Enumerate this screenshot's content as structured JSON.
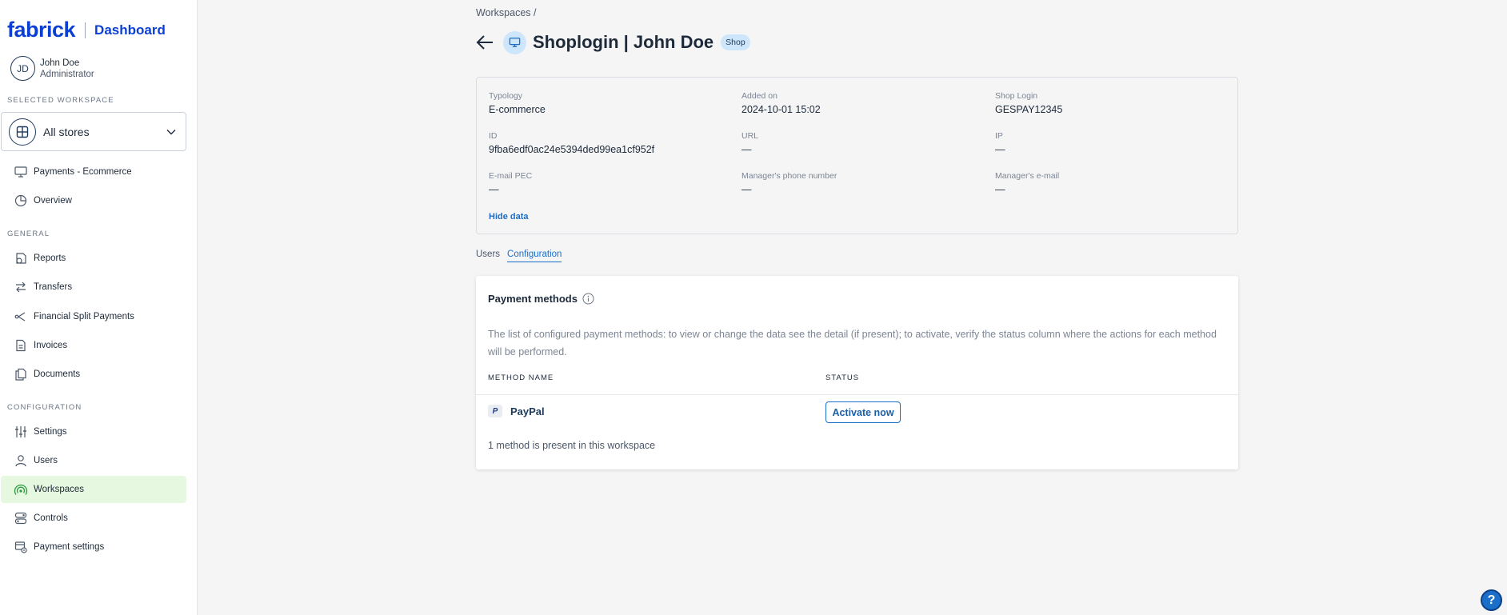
{
  "brand": {
    "logo": "fabrick",
    "subtitle": "Dashboard"
  },
  "user": {
    "initials": "JD",
    "name": "John Doe",
    "role": "Administrator"
  },
  "sidebar": {
    "selected_workspace_label": "SELECTED WORKSPACE",
    "workspace": {
      "value": "All stores",
      "icon": "grid-icon"
    },
    "top_items": [
      {
        "label": "Payments - Ecommerce",
        "icon": "monitor-icon"
      },
      {
        "label": "Overview",
        "icon": "pie-chart-icon"
      }
    ],
    "general_label": "GENERAL",
    "general_items": [
      {
        "label": "Reports",
        "icon": "report-icon"
      },
      {
        "label": "Transfers",
        "icon": "transfer-icon"
      },
      {
        "label": "Financial Split Payments",
        "icon": "split-icon"
      },
      {
        "label": "Invoices",
        "icon": "invoice-icon"
      },
      {
        "label": "Documents",
        "icon": "documents-icon"
      }
    ],
    "configuration_label": "CONFIGURATION",
    "configuration_items": [
      {
        "label": "Settings",
        "icon": "sliders-icon"
      },
      {
        "label": "Users",
        "icon": "user-icon"
      },
      {
        "label": "Workspaces",
        "icon": "workspace-icon",
        "active": true
      },
      {
        "label": "Controls",
        "icon": "controls-icon"
      },
      {
        "label": "Payment settings",
        "icon": "payment-settings-icon"
      }
    ]
  },
  "header": {
    "breadcrumb": "Workspaces /",
    "title": "Shoplogin | John Doe",
    "badge": "Shop"
  },
  "details": {
    "typology": {
      "label": "Typology",
      "value": "E-commerce"
    },
    "added_on": {
      "label": "Added on",
      "value": "2024-10-01 15:02"
    },
    "shop_login": {
      "label": "Shop Login",
      "value": "GESPAY12345"
    },
    "id": {
      "label": "ID",
      "value": "9fba6edf0ac24e5394ded99ea1cf952f"
    },
    "url": {
      "label": "URL",
      "value": "—"
    },
    "ip": {
      "label": "IP",
      "value": "—"
    },
    "email_pec": {
      "label": "E-mail PEC",
      "value": "—"
    },
    "manager_phone": {
      "label": "Manager's phone number",
      "value": "—"
    },
    "manager_email": {
      "label": "Manager's e-mail",
      "value": "—"
    },
    "hide_link": "Hide data"
  },
  "tabs": [
    {
      "label": "Users",
      "active": false
    },
    {
      "label": "Configuration",
      "active": true
    }
  ],
  "payment_methods": {
    "title": "Payment methods",
    "description": "The list of configured payment methods: to view or change the data see the detail (if present); to activate, verify the status column where the actions for each method will be performed.",
    "columns": {
      "method": "METHOD NAME",
      "status": "STATUS"
    },
    "rows": [
      {
        "logo": "P",
        "name": "PayPal",
        "action": "Activate now"
      }
    ],
    "footer": "1 method is present in this workspace"
  },
  "help": {
    "label": "?"
  }
}
